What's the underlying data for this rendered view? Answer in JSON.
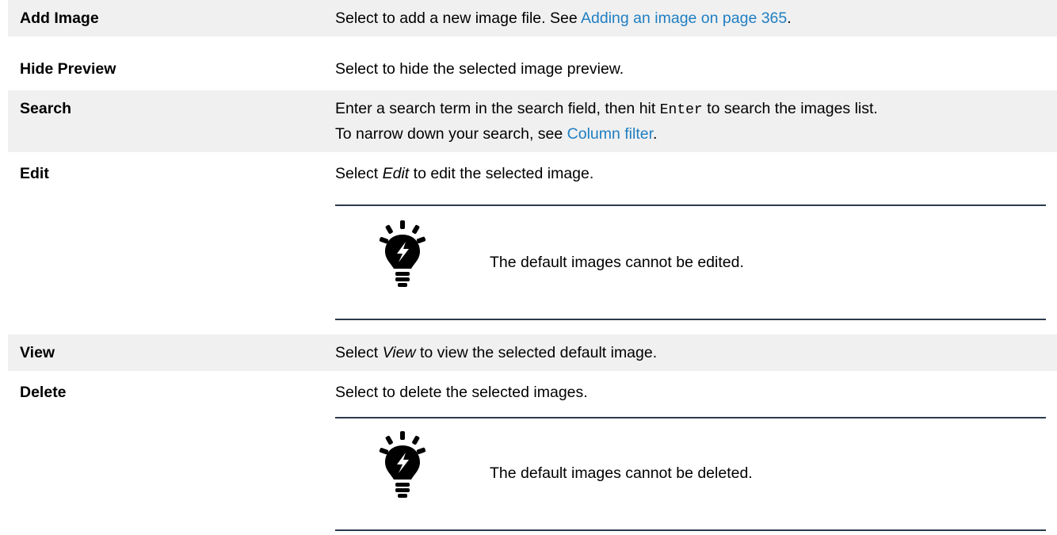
{
  "rows": [
    {
      "term": "Add Image",
      "desc_before": "Select to add a new image file. See ",
      "desc_link": "Adding an image on page 365",
      "desc_after": "."
    },
    {
      "term": "Hide Preview",
      "desc": "Select to hide the selected image preview."
    },
    {
      "term": "Search",
      "desc_before": "Enter a search term in the search field, then hit ",
      "desc_code": "Enter",
      "desc_mid": " to search the images list.",
      "desc_line2_before": "To narrow down your search, see ",
      "desc_link": "Column filter",
      "desc_after": "."
    },
    {
      "term": "Edit",
      "desc_before": "Select ",
      "desc_em": "Edit",
      "desc_after": " to edit the selected image.",
      "note": "The default images cannot be edited.",
      "note_icon": "lightbulb-tip-icon"
    },
    {
      "term": "View",
      "desc_before": "Select ",
      "desc_em": "View",
      "desc_after": " to view the selected default image."
    },
    {
      "term": "Delete",
      "desc": "Select to delete the selected images.",
      "note": "The default images cannot be deleted.",
      "note_icon": "lightbulb-tip-icon"
    }
  ],
  "colors": {
    "row_shade": "#f0f0f0",
    "link": "#1f7ec2",
    "note_rule": "#2b3a4d"
  }
}
